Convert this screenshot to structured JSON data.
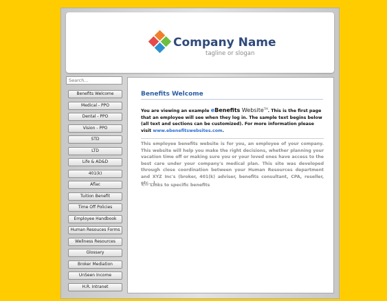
{
  "header": {
    "company_name": "Company Name",
    "tagline": "tagline or slogan"
  },
  "search": {
    "placeholder": "Search..."
  },
  "nav": {
    "items": [
      {
        "label": "Benefits Welcome"
      },
      {
        "label": "Medical - PPO"
      },
      {
        "label": "Dental - PPO"
      },
      {
        "label": "Vision - PPO"
      },
      {
        "label": "STD"
      },
      {
        "label": "LTD"
      },
      {
        "label": "Life & AD&D"
      },
      {
        "label": "401(k)"
      },
      {
        "label": "Aflac"
      },
      {
        "label": "Tuition Benefit"
      },
      {
        "label": "Time Off Policies"
      },
      {
        "label": "Employee Handbook"
      },
      {
        "label": "Human Resouces Forms"
      },
      {
        "label": "Wellness Resources"
      },
      {
        "label": "Glossary"
      },
      {
        "label": "Broker Mediation"
      },
      {
        "label": "UnSeen Income"
      },
      {
        "label": "H.R. Intranet"
      }
    ]
  },
  "main": {
    "title": "Benefits Welcome",
    "intro": {
      "prefix": "You are viewing an example ",
      "brand_e": "e",
      "brand_word": "Benefits",
      "brand_site": " Website",
      "brand_tm": "TM",
      "suffix": ".  This is the first page that an employee will see when they log in.  The sample text begins below (all text and sections can be customized).  For more information please visit ",
      "link": "www.ebenefitswebsites.com",
      "end": "."
    },
    "description": "This employee benefits website is for you, an employee of your company.  This website will help you make the right decisions, whether planning your vacation time off or making sure you or your loved ones have access to the best care under your company's medical plan.  This site was developed through close coordination between your Human Resources department and XYZ Inc's (broker, 401(k) adviser, benefits consultant, CPA, reseller, etc...).",
    "pointer": "<— Links to specific benefits"
  },
  "colors": {
    "background": "#ffcc00",
    "title_blue": "#2d5ea3",
    "brand_blue": "#2d6fd1",
    "company_name": "#2f4a7a",
    "body_gray": "#8c8c8c"
  },
  "icons": {
    "logo": "four-diamond-logo-icon"
  }
}
